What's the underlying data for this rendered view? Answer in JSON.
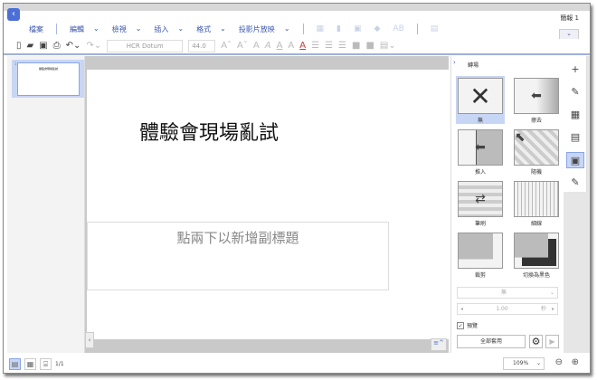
{
  "app": {
    "doc_title": "簡報 1"
  },
  "menu": {
    "items": [
      "檔案",
      "編輯",
      "檢視",
      "插入",
      "格式",
      "投影片放映"
    ]
  },
  "toolbar": {
    "font": "HCR Dotum",
    "size": "44.0"
  },
  "slide": {
    "title": "體驗會現場亂試",
    "subtitle_placeholder": "點兩下以新增副標題",
    "thumb_number": "1",
    "thumb_title": "體驗會現場亂試"
  },
  "panel": {
    "title": "轉場",
    "transitions": [
      "無",
      "擦去",
      "推入",
      "隨機",
      "筆刷",
      "細線",
      "裁剪",
      "切換為黑色"
    ],
    "selected": "無",
    "effect_select": "無",
    "duration": "1.00",
    "duration_unit": "秒",
    "preview_label": "預覽",
    "preview_checked": true,
    "apply_all": "全部套用"
  },
  "status": {
    "page": "1/1",
    "zoom": "109%"
  }
}
